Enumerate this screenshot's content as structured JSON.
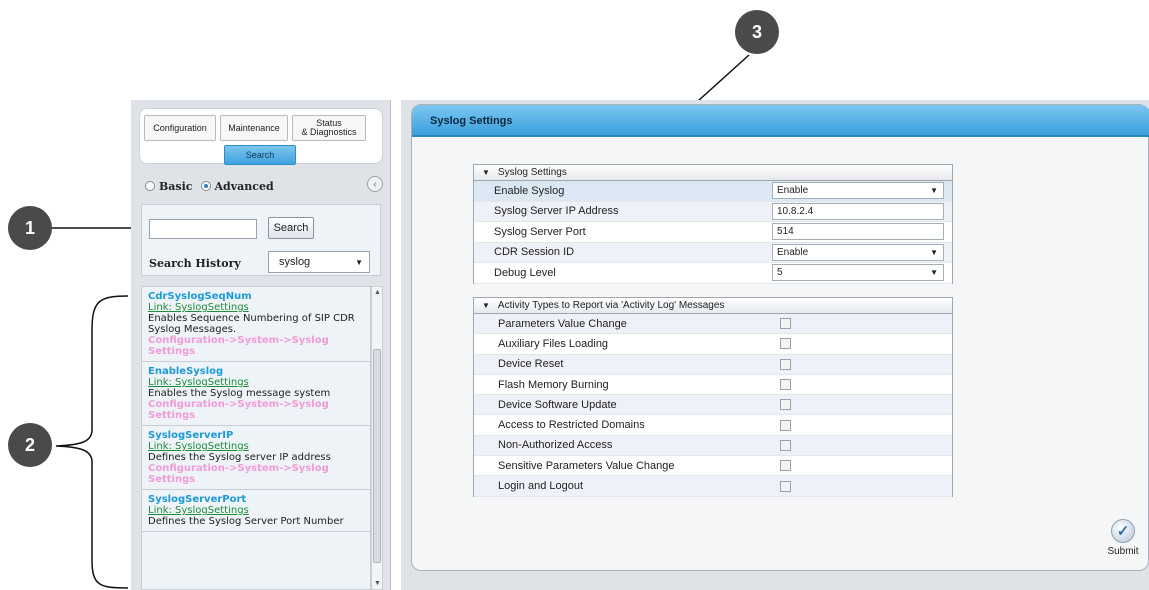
{
  "callouts": [
    "1",
    "2",
    "3"
  ],
  "nav": {
    "tabs": [
      "Configuration",
      "Maintenance",
      "Status\n& Diagnostics"
    ],
    "search_tab": "Search"
  },
  "mode": {
    "basic": "Basic",
    "advanced": "Advanced",
    "selected": "Advanced"
  },
  "search": {
    "input_value": "",
    "button": "Search",
    "history_label": "Search History",
    "history_value": "syslog"
  },
  "results": [
    {
      "name": "CdrSyslogSeqNum",
      "link": "Link: SyslogSettings",
      "description": "Enables Sequence Numbering of SIP CDR Syslog Messages.",
      "path": "Configuration->System->Syslog Settings"
    },
    {
      "name": "EnableSyslog",
      "link": "Link: SyslogSettings",
      "description": "Enables the Syslog message system",
      "path": "Configuration->System->Syslog Settings"
    },
    {
      "name": "SyslogServerIP",
      "link": "Link: SyslogSettings",
      "description": "Defines the Syslog server IP address",
      "path": "Configuration->System->Syslog Settings"
    },
    {
      "name": "SyslogServerPort",
      "link": "Link: SyslogSettings",
      "description": "Defines the Syslog Server Port Number",
      "path": ""
    }
  ],
  "page_title": "Syslog Settings",
  "syslog_section": {
    "title": "Syslog Settings",
    "rows": [
      {
        "label": "Enable Syslog",
        "value": "Enable",
        "type": "select"
      },
      {
        "label": "Syslog Server IP Address",
        "value": "10.8.2.4",
        "type": "text"
      },
      {
        "label": "Syslog Server Port",
        "value": "514",
        "type": "text"
      },
      {
        "label": "CDR Session ID",
        "value": "Enable",
        "type": "select"
      },
      {
        "label": "Debug Level",
        "value": "5",
        "type": "select"
      }
    ]
  },
  "activity_section": {
    "title": "Activity Types to Report via 'Activity Log' Messages",
    "rows": [
      "Parameters Value Change",
      "Auxiliary Files Loading",
      "Device Reset",
      "Flash Memory Burning",
      "Device Software Update",
      "Access to Restricted Domains",
      "Non-Authorized Access",
      "Sensitive Parameters Value Change",
      "Login and Logout"
    ]
  },
  "submit_label": "Submit"
}
